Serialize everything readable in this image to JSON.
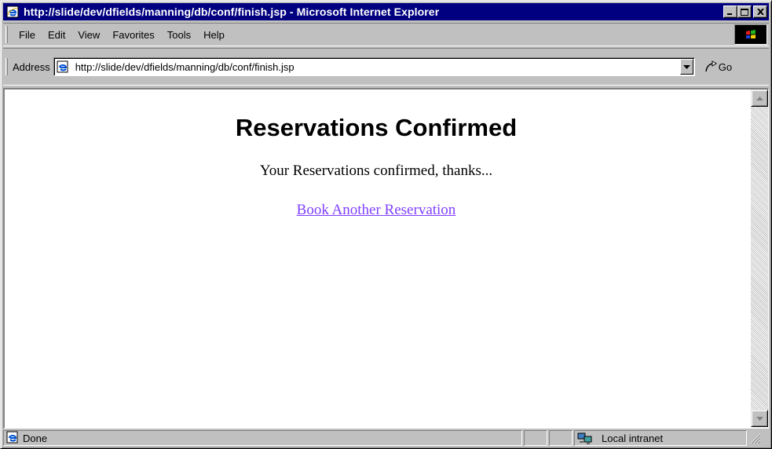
{
  "window": {
    "title": "http://slide/dev/dfields/manning/db/conf/finish.jsp - Microsoft Internet Explorer",
    "minimize_label": "_",
    "maximize_label": "□",
    "close_label": "×"
  },
  "menu": {
    "items": [
      {
        "label": "File"
      },
      {
        "label": "Edit"
      },
      {
        "label": "View"
      },
      {
        "label": "Favorites"
      },
      {
        "label": "Tools"
      },
      {
        "label": "Help"
      }
    ]
  },
  "address": {
    "label": "Address",
    "url": "http://slide/dev/dfields/manning/db/conf/finish.jsp",
    "go_label": "Go"
  },
  "page": {
    "heading": "Reservations Confirmed",
    "message": "Your Reservations confirmed, thanks...",
    "link_label": "Book Another Reservation",
    "link_color": "#7f3fff"
  },
  "status": {
    "text": "Done",
    "zone": "Local intranet"
  },
  "colors": {
    "titlebar": "#000080",
    "chrome": "#c0c0c0"
  }
}
